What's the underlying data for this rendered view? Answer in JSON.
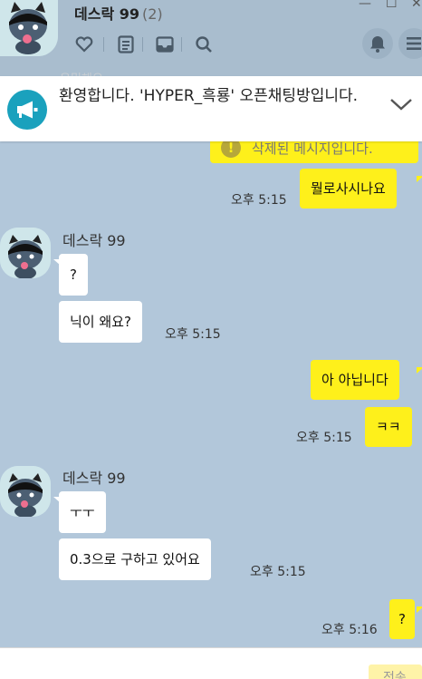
{
  "header": {
    "room_name": "데스락 99",
    "member_count": "(2)",
    "window_controls": [
      "—",
      "☐",
      "✕"
    ],
    "icons": [
      "heart-icon",
      "note-icon",
      "inbox-icon",
      "search-icon",
      "bell-icon",
      "menu-icon"
    ]
  },
  "notice": {
    "text": "환영합니다. 'HYPER_흑룡' 오픈채팅방입니다.",
    "peek_text": "은밀해요"
  },
  "messages": {
    "deleted_text": "삭제된 메시지입니다.",
    "m1": {
      "text": "뭘로사시나요",
      "time": "오후 5:15"
    },
    "g1": {
      "sender": "데스락 99",
      "b1": "?",
      "b2": "닉이 왜요?",
      "time": "오후 5:15"
    },
    "m2": {
      "b1": "아 아닙니다",
      "b2": "ㅋㅋ",
      "time": "오후 5:15"
    },
    "g2": {
      "sender": "데스락 99",
      "b1": "ㅜㅜ",
      "b2": "0.3으로 구하고 있어요",
      "time": "오후 5:15"
    },
    "m3": {
      "text": "?",
      "time": "오후 5:16"
    }
  },
  "input": {
    "send_label": "전송"
  },
  "colors": {
    "background": "#b2c7da",
    "my_bubble": "#fef01b",
    "their_bubble": "#ffffff",
    "notice_icon": "#1aa1bd"
  }
}
